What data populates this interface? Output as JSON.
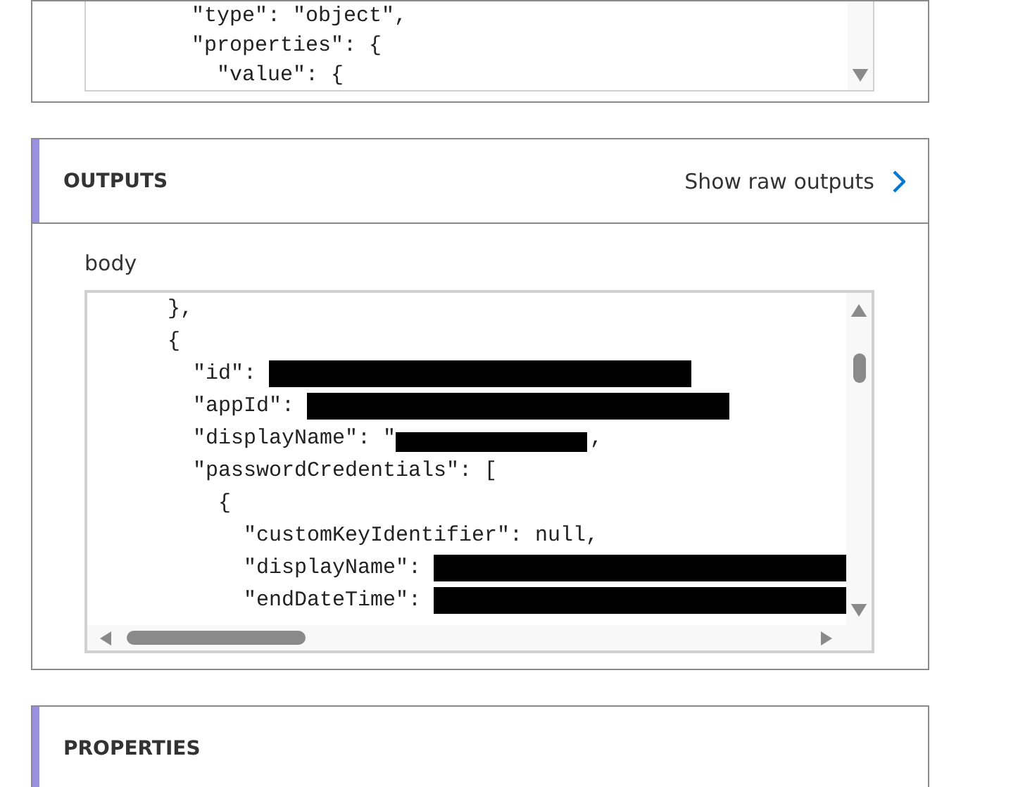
{
  "inputs_code": {
    "lines": [
      {
        "text": "        \"type\": \"object\","
      },
      {
        "text": "        \"properties\": {"
      },
      {
        "text": "          \"value\": {"
      }
    ]
  },
  "outputs": {
    "title": "OUTPUTS",
    "action": "Show raw outputs",
    "field_label": "body",
    "code": {
      "lines": [
        {
          "text": "      },"
        },
        {
          "text": "      {"
        },
        {
          "text": "        \"id\": ",
          "redacted": true
        },
        {
          "text": "        \"appId\": ",
          "redacted": true
        },
        {
          "text": "        \"displayName\": \"",
          "redacted": true,
          "after": ","
        },
        {
          "text": "        \"passwordCredentials\": ["
        },
        {
          "text": "          {"
        },
        {
          "text": "            \"customKeyIdentifier\": null,"
        },
        {
          "text": "            \"displayName\": ",
          "redacted": true
        },
        {
          "text": "            \"endDateTime\": ",
          "redacted": true
        }
      ]
    }
  },
  "properties": {
    "title": "PROPERTIES"
  }
}
